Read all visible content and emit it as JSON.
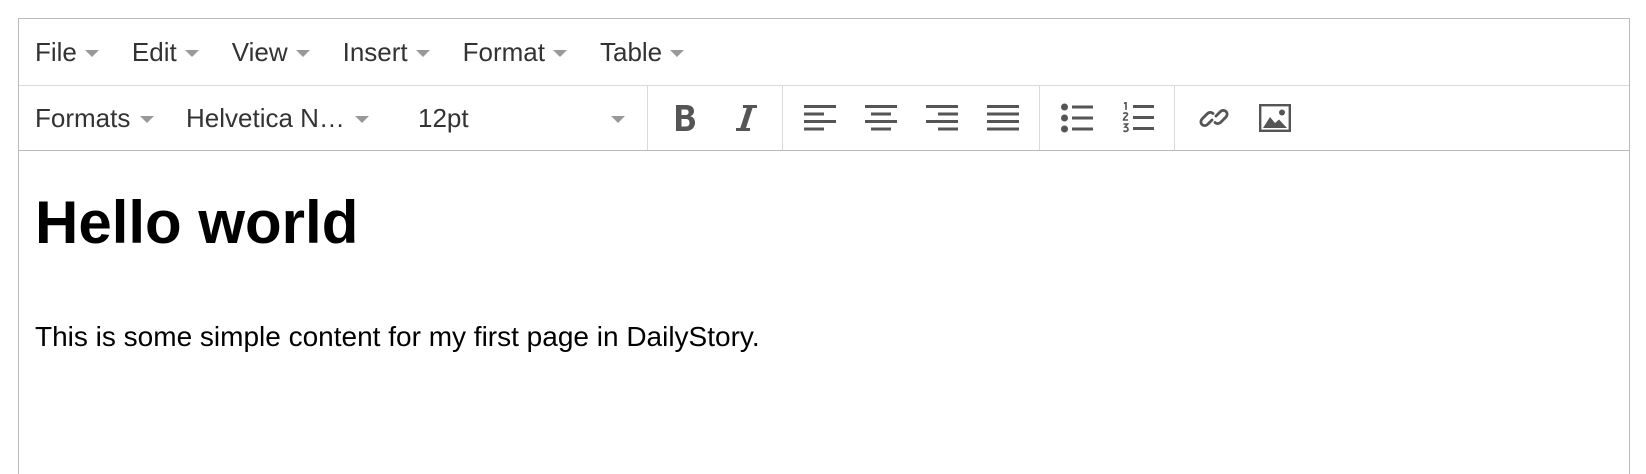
{
  "menubar": {
    "items": [
      {
        "label": "File"
      },
      {
        "label": "Edit"
      },
      {
        "label": "View"
      },
      {
        "label": "Insert"
      },
      {
        "label": "Format"
      },
      {
        "label": "Table"
      }
    ]
  },
  "toolbar": {
    "formats_label": "Formats",
    "font_family_value": "Helvetica N…",
    "font_size_value": "12pt",
    "buttons": [
      "bold-icon",
      "italic-icon",
      "align-left-icon",
      "align-center-icon",
      "align-right-icon",
      "align-justify-icon",
      "bullet-list-icon",
      "numbered-list-icon",
      "link-icon",
      "image-icon"
    ],
    "icon_color": "#555555"
  },
  "content": {
    "heading": "Hello world",
    "paragraph": "This is some simple content for my first page in DailyStory."
  }
}
